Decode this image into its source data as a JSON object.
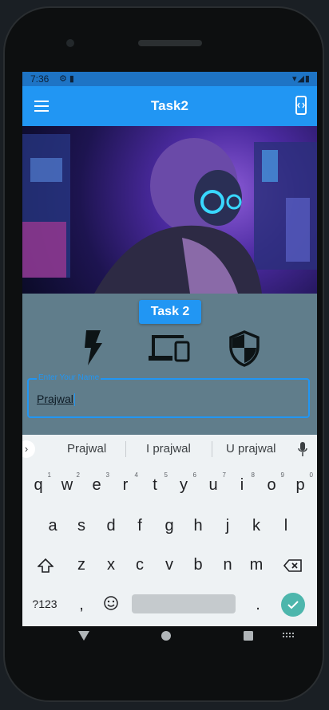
{
  "status": {
    "time": "7:36",
    "icons": "⚙ ▮",
    "right": "▾◢▮"
  },
  "appbar": {
    "title": "Task2"
  },
  "content": {
    "task_button": "Task 2"
  },
  "field": {
    "label": "Enter Your Name",
    "value": "Prajwal"
  },
  "keyboard": {
    "suggestions": [
      "Prajwal",
      "I prajwal",
      "U prajwal"
    ],
    "row1": [
      "q",
      "w",
      "e",
      "r",
      "t",
      "y",
      "u",
      "i",
      "o",
      "p"
    ],
    "row1_nums": [
      "1",
      "2",
      "3",
      "4",
      "5",
      "6",
      "7",
      "8",
      "9",
      "0"
    ],
    "row2": [
      "a",
      "s",
      "d",
      "f",
      "g",
      "h",
      "j",
      "k",
      "l"
    ],
    "row3": [
      "z",
      "x",
      "c",
      "v",
      "b",
      "n",
      "m"
    ],
    "symbols_key": "?123",
    "comma": ",",
    "period": "."
  },
  "colors": {
    "accent": "#2196f3",
    "body": "#607d8b",
    "enter": "#4db6ac"
  },
  "icons": [
    "flash-icon",
    "devices-icon",
    "shield-icon"
  ]
}
